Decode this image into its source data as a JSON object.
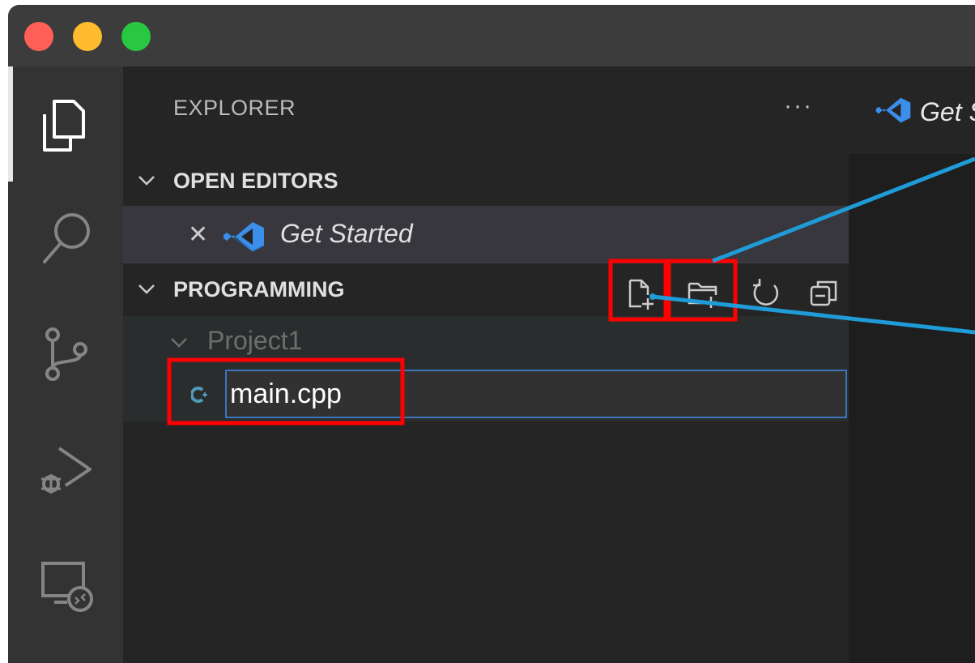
{
  "sidebar": {
    "title": "EXPLORER",
    "more": "···",
    "open_editors": {
      "label": "OPEN EDITORS",
      "items": [
        {
          "title": "Get Started"
        }
      ]
    },
    "folder": {
      "label": "PROGRAMMING",
      "actions": [
        "new-file",
        "new-folder",
        "refresh",
        "collapse-all"
      ],
      "project": {
        "label": "Project1"
      },
      "new_file_value": "main.cpp"
    }
  },
  "editor": {
    "tab_title": "Get Started"
  },
  "colors": {
    "activity_bar": "#333333",
    "sidebar": "#252526",
    "editor": "#1e1e1e",
    "titlebar": "#3c3c3c",
    "input_border": "#3a75bd",
    "highlight_box": "#ff0000",
    "callout_line": "#1f9bd7",
    "vscode_blue": "#3b8eea"
  },
  "icons": [
    "files-icon",
    "search-icon",
    "source-control-icon",
    "run-debug-icon",
    "remote-explorer-icon",
    "vscode-logo-icon",
    "cpp-file-icon"
  ]
}
